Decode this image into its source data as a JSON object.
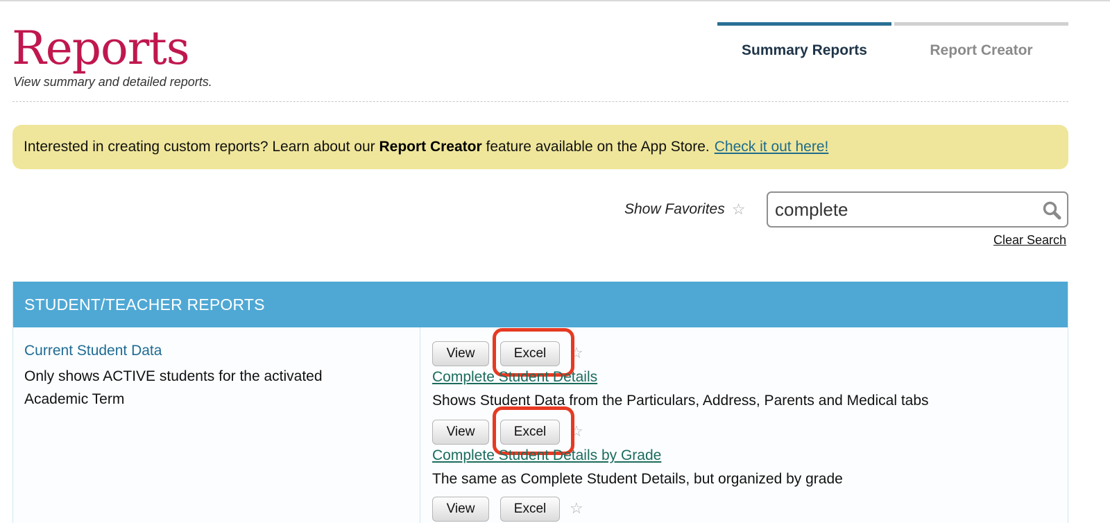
{
  "header": {
    "title": "Reports",
    "subtitle": "View summary and detailed reports."
  },
  "tabs": [
    {
      "label": "Summary Reports",
      "active": true
    },
    {
      "label": "Report Creator",
      "active": false
    }
  ],
  "promo": {
    "text_before": "Interested in creating custom reports? Learn about our",
    "bold": "Report Creator",
    "text_after": "feature available on the App Store.",
    "link": "Check it out here!"
  },
  "favorites": {
    "label": "Show Favorites",
    "star": "☆",
    "icon": "star-outline-icon"
  },
  "search": {
    "value": "complete",
    "icon": "search-icon",
    "clear_label": "Clear Search"
  },
  "section": {
    "title": "STUDENT/TEACHER REPORTS",
    "category": {
      "title": "Current Student Data",
      "description": "Only shows ACTIVE students for the activated Academic Term"
    },
    "buttons": {
      "view": "View",
      "excel": "Excel"
    },
    "star": "☆",
    "reports": [
      {
        "title": "Complete Student Details",
        "description": "Shows Student Data from the Particulars, Address, Parents and Medical tabs",
        "excel_highlighted": true
      },
      {
        "title": "Complete Student Details by Grade",
        "description": "The same as Complete Student Details, but organized by grade",
        "excel_highlighted": true
      },
      {
        "title": "",
        "description": "",
        "excel_highlighted": false
      }
    ]
  },
  "colors": {
    "title": "#c0174e",
    "active_tab": "#2a6f95",
    "promo_bg": "#efe69b",
    "section_header": "#4fa8d4",
    "highlight": "#e63a22"
  }
}
